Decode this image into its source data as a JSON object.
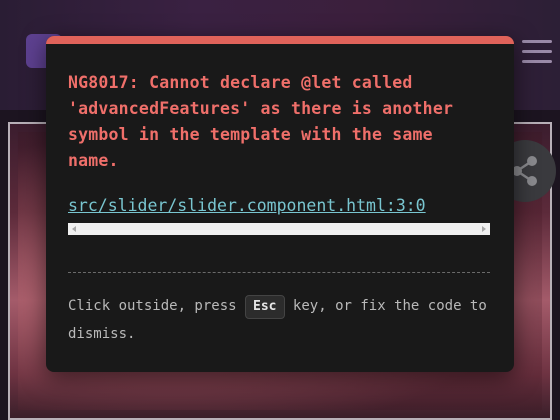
{
  "overlay": {
    "accent_color": "#e0635a",
    "error_message": "NG8017: Cannot declare @let called\n'advancedFeatures' as there is another\nsymbol in the template with the same\nname.",
    "file_link": "src/slider/slider.component.html:3:0",
    "dismiss": {
      "before": "Click outside, press ",
      "key": "Esc",
      "after": " key, or fix the code to dismiss."
    }
  },
  "background": {
    "menu_icon": "hamburger-menu-icon",
    "share_icon": "share-icon"
  }
}
